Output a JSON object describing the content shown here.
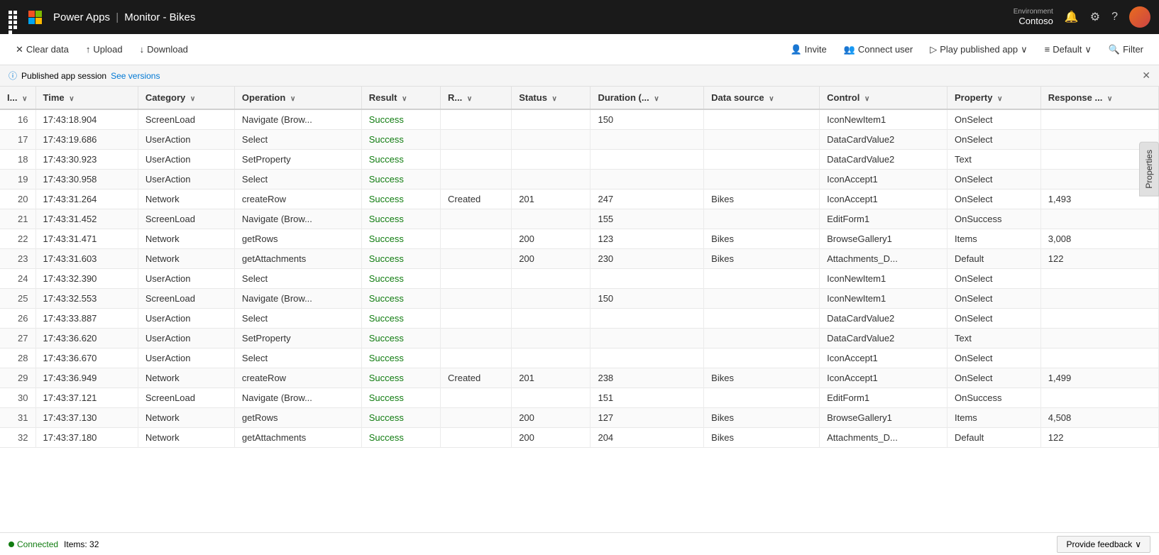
{
  "topbar": {
    "app_name": "Power Apps",
    "separator": "|",
    "title": "Monitor - Bikes",
    "environment_label": "Environment",
    "environment_name": "Contoso"
  },
  "toolbar": {
    "clear_data": "Clear data",
    "upload": "Upload",
    "download": "Download",
    "invite": "Invite",
    "connect_user": "Connect user",
    "play_published_app": "Play published app",
    "default": "Default",
    "filter": "Filter"
  },
  "infobar": {
    "text": "Published app session",
    "link": "See versions"
  },
  "table": {
    "columns": [
      "I...",
      "Time",
      "Category",
      "Operation",
      "Result",
      "R...",
      "Status",
      "Duration (...",
      "Data source",
      "Control",
      "Property",
      "Response ..."
    ],
    "rows": [
      {
        "id": "16",
        "time": "17:43:18.904",
        "category": "ScreenLoad",
        "operation": "Navigate (Brow...",
        "result": "Success",
        "r": "",
        "status": "",
        "duration": "150",
        "datasource": "",
        "control": "IconNewItem1",
        "property": "OnSelect",
        "response": ""
      },
      {
        "id": "17",
        "time": "17:43:19.686",
        "category": "UserAction",
        "operation": "Select",
        "result": "Success",
        "r": "",
        "status": "",
        "duration": "",
        "datasource": "",
        "control": "DataCardValue2",
        "property": "OnSelect",
        "response": ""
      },
      {
        "id": "18",
        "time": "17:43:30.923",
        "category": "UserAction",
        "operation": "SetProperty",
        "result": "Success",
        "r": "",
        "status": "",
        "duration": "",
        "datasource": "",
        "control": "DataCardValue2",
        "property": "Text",
        "response": ""
      },
      {
        "id": "19",
        "time": "17:43:30.958",
        "category": "UserAction",
        "operation": "Select",
        "result": "Success",
        "r": "",
        "status": "",
        "duration": "",
        "datasource": "",
        "control": "IconAccept1",
        "property": "OnSelect",
        "response": ""
      },
      {
        "id": "20",
        "time": "17:43:31.264",
        "category": "Network",
        "operation": "createRow",
        "result": "Success",
        "r": "Created",
        "status": "201",
        "duration": "247",
        "datasource": "Bikes",
        "control": "IconAccept1",
        "property": "OnSelect",
        "response": "1,493"
      },
      {
        "id": "21",
        "time": "17:43:31.452",
        "category": "ScreenLoad",
        "operation": "Navigate (Brow...",
        "result": "Success",
        "r": "",
        "status": "",
        "duration": "155",
        "datasource": "",
        "control": "EditForm1",
        "property": "OnSuccess",
        "response": ""
      },
      {
        "id": "22",
        "time": "17:43:31.471",
        "category": "Network",
        "operation": "getRows",
        "result": "Success",
        "r": "",
        "status": "200",
        "duration": "123",
        "datasource": "Bikes",
        "control": "BrowseGallery1",
        "property": "Items",
        "response": "3,008"
      },
      {
        "id": "23",
        "time": "17:43:31.603",
        "category": "Network",
        "operation": "getAttachments",
        "result": "Success",
        "r": "",
        "status": "200",
        "duration": "230",
        "datasource": "Bikes",
        "control": "Attachments_D...",
        "property": "Default",
        "response": "122"
      },
      {
        "id": "24",
        "time": "17:43:32.390",
        "category": "UserAction",
        "operation": "Select",
        "result": "Success",
        "r": "",
        "status": "",
        "duration": "",
        "datasource": "",
        "control": "IconNewItem1",
        "property": "OnSelect",
        "response": ""
      },
      {
        "id": "25",
        "time": "17:43:32.553",
        "category": "ScreenLoad",
        "operation": "Navigate (Brow...",
        "result": "Success",
        "r": "",
        "status": "",
        "duration": "150",
        "datasource": "",
        "control": "IconNewItem1",
        "property": "OnSelect",
        "response": ""
      },
      {
        "id": "26",
        "time": "17:43:33.887",
        "category": "UserAction",
        "operation": "Select",
        "result": "Success",
        "r": "",
        "status": "",
        "duration": "",
        "datasource": "",
        "control": "DataCardValue2",
        "property": "OnSelect",
        "response": ""
      },
      {
        "id": "27",
        "time": "17:43:36.620",
        "category": "UserAction",
        "operation": "SetProperty",
        "result": "Success",
        "r": "",
        "status": "",
        "duration": "",
        "datasource": "",
        "control": "DataCardValue2",
        "property": "Text",
        "response": ""
      },
      {
        "id": "28",
        "time": "17:43:36.670",
        "category": "UserAction",
        "operation": "Select",
        "result": "Success",
        "r": "",
        "status": "",
        "duration": "",
        "datasource": "",
        "control": "IconAccept1",
        "property": "OnSelect",
        "response": ""
      },
      {
        "id": "29",
        "time": "17:43:36.949",
        "category": "Network",
        "operation": "createRow",
        "result": "Success",
        "r": "Created",
        "status": "201",
        "duration": "238",
        "datasource": "Bikes",
        "control": "IconAccept1",
        "property": "OnSelect",
        "response": "1,499"
      },
      {
        "id": "30",
        "time": "17:43:37.121",
        "category": "ScreenLoad",
        "operation": "Navigate (Brow...",
        "result": "Success",
        "r": "",
        "status": "",
        "duration": "151",
        "datasource": "",
        "control": "EditForm1",
        "property": "OnSuccess",
        "response": ""
      },
      {
        "id": "31",
        "time": "17:43:37.130",
        "category": "Network",
        "operation": "getRows",
        "result": "Success",
        "r": "",
        "status": "200",
        "duration": "127",
        "datasource": "Bikes",
        "control": "BrowseGallery1",
        "property": "Items",
        "response": "4,508"
      },
      {
        "id": "32",
        "time": "17:43:37.180",
        "category": "Network",
        "operation": "getAttachments",
        "result": "Success",
        "r": "",
        "status": "200",
        "duration": "204",
        "datasource": "Bikes",
        "control": "Attachments_D...",
        "property": "Default",
        "response": "122"
      }
    ]
  },
  "right_panel": {
    "label": "Properties"
  },
  "status_bar": {
    "connected": "Connected",
    "items": "Items: 32",
    "feedback": "Provide feedback"
  }
}
